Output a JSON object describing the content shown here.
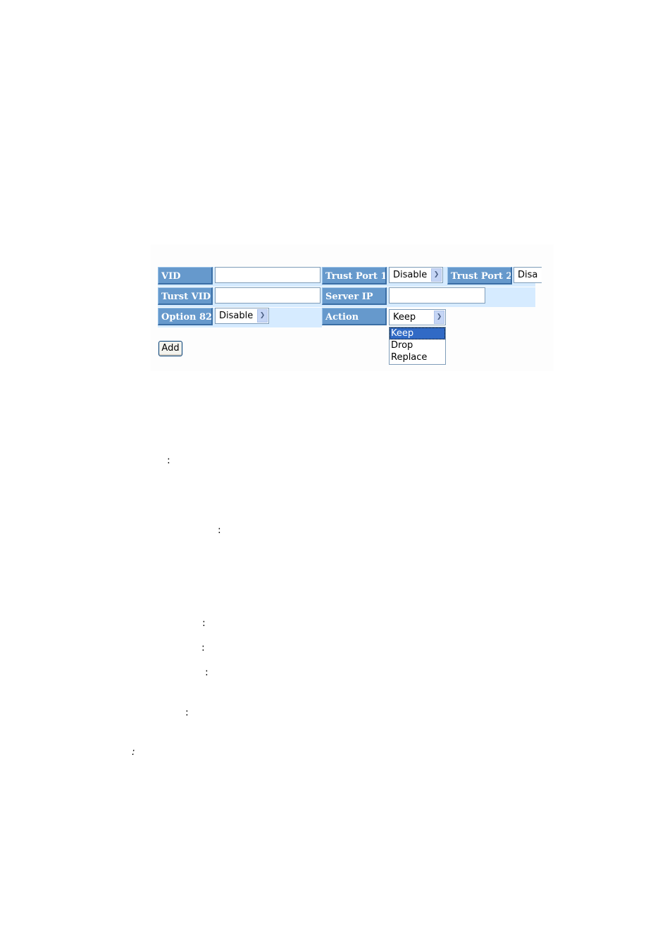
{
  "form": {
    "rows": [
      {
        "label": "VID",
        "value": ""
      },
      {
        "label": "Turst VID",
        "value": ""
      },
      {
        "label": "Option 82",
        "value": "Disable"
      }
    ],
    "trust_port_1": {
      "label": "Trust Port 1",
      "value": "Disable"
    },
    "trust_port_2": {
      "label": "Trust Port 2",
      "value": "Disa"
    },
    "server_ip": {
      "label": "Server IP",
      "value": ""
    },
    "action": {
      "label": "Action",
      "value": "Keep",
      "options": [
        "Keep",
        "Drop",
        "Replace"
      ],
      "highlighted": "Keep"
    },
    "add_label": "Add"
  },
  "colons": [
    ":",
    ":",
    ":",
    ":",
    ":",
    ":",
    ":"
  ],
  "colors": {
    "label_bg": "#6699cc",
    "row_bg": "#d6ebff",
    "selected_option": "#316ac5"
  }
}
